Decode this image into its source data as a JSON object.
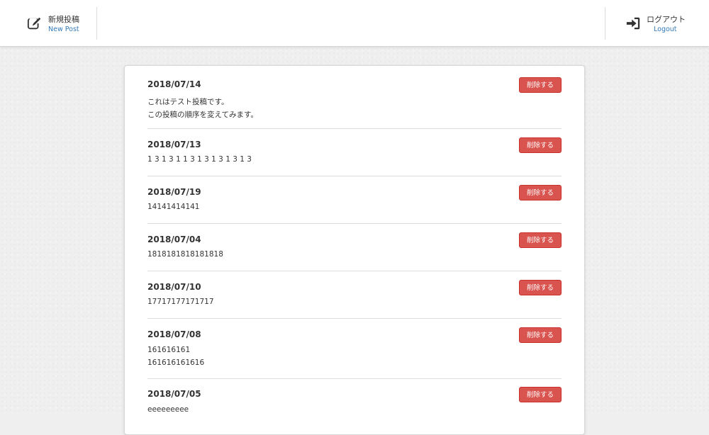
{
  "header": {
    "new_post": {
      "label_jp": "新規投稿",
      "label_en": "New Post",
      "icon": "edit-icon"
    },
    "logout": {
      "label_jp": "ログアウト",
      "label_en": "Logout",
      "icon": "sign-in-icon"
    }
  },
  "posts": [
    {
      "date": "2018/07/14",
      "lines": [
        "これはテスト投稿です。",
        "この投稿の順序を変えてみます。"
      ],
      "delete_label": "削除する"
    },
    {
      "date": "2018/07/13",
      "lines": [
        "1 3 1 3 1 1 3 1 3 1 3 1 3 1 3"
      ],
      "delete_label": "削除する"
    },
    {
      "date": "2018/07/19",
      "lines": [
        "14141414141"
      ],
      "delete_label": "削除する"
    },
    {
      "date": "2018/07/04",
      "lines": [
        "1818181818181818"
      ],
      "delete_label": "削除する"
    },
    {
      "date": "2018/07/10",
      "lines": [
        "17717177171717"
      ],
      "delete_label": "削除する"
    },
    {
      "date": "2018/07/08",
      "lines": [
        "161616161",
        "161616161616"
      ],
      "delete_label": "削除する"
    },
    {
      "date": "2018/07/05",
      "lines": [
        "eeeeeeeee"
      ],
      "delete_label": "削除する"
    }
  ],
  "colors": {
    "delete_button": "#d9534f",
    "link_blue": "#337ab7"
  }
}
